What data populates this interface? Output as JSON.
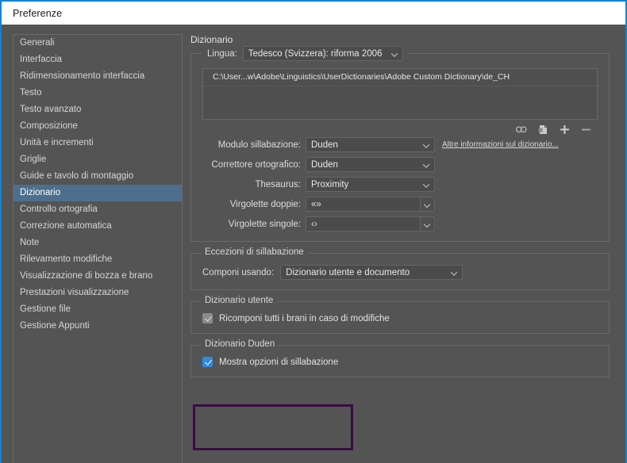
{
  "window": {
    "title": "Preferenze",
    "accent_color": "#0a84d8"
  },
  "sidebar": {
    "items": [
      {
        "label": "Generali",
        "selected": false
      },
      {
        "label": "Interfaccia",
        "selected": false
      },
      {
        "label": "Ridimensionamento interfaccia",
        "selected": false
      },
      {
        "label": "Testo",
        "selected": false
      },
      {
        "label": "Testo avanzato",
        "selected": false
      },
      {
        "label": "Composizione",
        "selected": false
      },
      {
        "label": "Unità e incrementi",
        "selected": false
      },
      {
        "label": "Griglie",
        "selected": false
      },
      {
        "label": "Guide e tavolo di montaggio",
        "selected": false
      },
      {
        "label": "Dizionario",
        "selected": true
      },
      {
        "label": "Controllo ortografia",
        "selected": false
      },
      {
        "label": "Correzione automatica",
        "selected": false
      },
      {
        "label": "Note",
        "selected": false
      },
      {
        "label": "Rilevamento modifiche",
        "selected": false
      },
      {
        "label": "Visualizzazione di bozza e brano",
        "selected": false
      },
      {
        "label": "Prestazioni visualizzazione",
        "selected": false
      },
      {
        "label": "Gestione file",
        "selected": false
      },
      {
        "label": "Gestione Appunti",
        "selected": false
      }
    ],
    "selection_color": "#4d6f8d"
  },
  "main": {
    "heading": "Dizionario",
    "language_group": {
      "legend_label": "Lingua:",
      "language_value": "Tedesco (Svizzera): riforma 2006",
      "dictionary_paths": [
        "C:\\User...w\\Adobe\\Linguistics\\UserDictionaries\\Adobe Custom Dictionary\\de_CH"
      ],
      "icons": [
        "link-icon",
        "new-dictionary-icon",
        "add-icon",
        "remove-icon"
      ],
      "fields": [
        {
          "label": "Modulo sillabazione:",
          "value": "Duden",
          "type": "select"
        },
        {
          "label": "Correttore ortografico:",
          "value": "Duden",
          "type": "select"
        },
        {
          "label": "Thesaurus:",
          "value": "Proximity",
          "type": "select"
        },
        {
          "label": "Virgolette doppie:",
          "value": "«»",
          "type": "combo"
        },
        {
          "label": "Virgolette singole:",
          "value": "‹›",
          "type": "combo"
        }
      ],
      "more_info_link": "Altre informazioni sul dizionario..."
    },
    "hyphenation_group": {
      "legend": "Eccezioni di sillabazione",
      "field_label": "Componi usando:",
      "field_value": "Dizionario utente e documento"
    },
    "user_dictionary_group": {
      "legend": "Dizionario utente",
      "checkbox_label": "Ricomponi tutti i brani in caso di modifiche",
      "checkbox_checked": true,
      "checkbox_style": "grey"
    },
    "duden_group": {
      "legend": "Dizionario Duden",
      "checkbox_label": "Mostra opzioni di sillabazione",
      "checkbox_checked": true,
      "checkbox_style": "blue",
      "highlight_color": "#3a0b42"
    }
  }
}
